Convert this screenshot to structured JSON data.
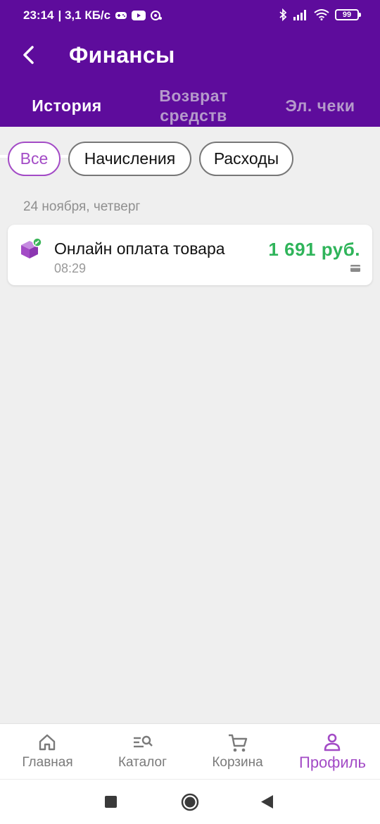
{
  "status_bar": {
    "time": "23:14",
    "network_speed": "| 3,1 КБ/с",
    "battery": "99"
  },
  "header": {
    "title": "Финансы"
  },
  "tabs": [
    {
      "label": "История",
      "active": true
    },
    {
      "label": "Возврат средств",
      "active": false
    },
    {
      "label": "Эл. чеки",
      "active": false
    }
  ],
  "filters": [
    {
      "label": "Все",
      "active": true
    },
    {
      "label": "Начисления",
      "active": false
    },
    {
      "label": "Расходы",
      "active": false
    }
  ],
  "transactions": {
    "date": "24 ноября, четверг",
    "items": [
      {
        "title": "Онлайн оплата товара",
        "time": "08:29",
        "amount": "1 691 руб."
      }
    ]
  },
  "bottom_nav": [
    {
      "label": "Главная",
      "icon": "home-icon"
    },
    {
      "label": "Каталог",
      "icon": "catalog-search-icon"
    },
    {
      "label": "Корзина",
      "icon": "cart-icon"
    },
    {
      "label": "Профиль",
      "icon": "profile-icon",
      "active": true
    }
  ],
  "colors": {
    "header_bg": "#5e0c9c",
    "accent": "#a34bc6",
    "amount_positive": "#2fb45a",
    "background": "#efefef"
  }
}
